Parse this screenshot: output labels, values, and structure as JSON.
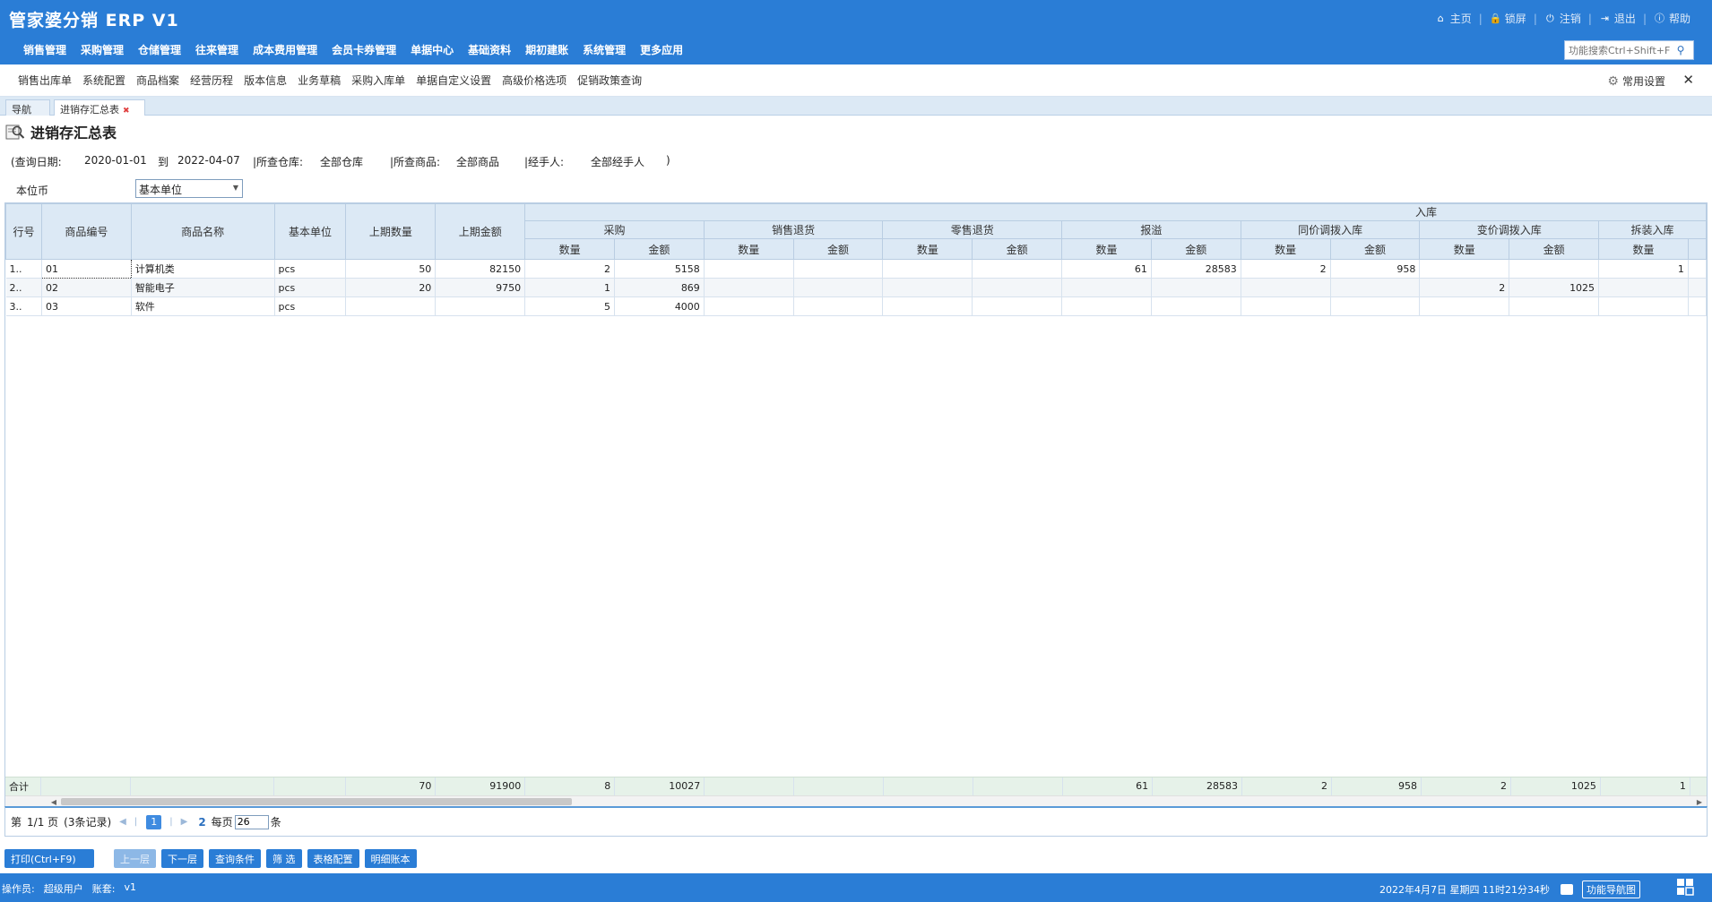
{
  "header": {
    "app_title": "管家婆分销 ERP V1",
    "links": [
      {
        "label": "主页",
        "icon": "home-icon"
      },
      {
        "label": "锁屏",
        "icon": "lock-icon"
      },
      {
        "label": "注销",
        "icon": "power-icon"
      },
      {
        "label": "退出",
        "icon": "exit-icon"
      },
      {
        "label": "帮助",
        "icon": "info-icon"
      }
    ],
    "menu": [
      "销售管理",
      "采购管理",
      "仓储管理",
      "往来管理",
      "成本费用管理",
      "会员卡券管理",
      "单据中心",
      "基础资料",
      "期初建账",
      "系统管理",
      "更多应用"
    ],
    "search_placeholder": "功能搜索Ctrl+Shift+F"
  },
  "subnav": {
    "items": [
      "销售出库单",
      "系统配置",
      "商品档案",
      "经营历程",
      "版本信息",
      "业务草稿",
      "采购入库单",
      "单据自定义设置",
      "高级价格选项",
      "促销政策查询"
    ],
    "common_settings": "常用设置",
    "close": "✕"
  },
  "tabs": {
    "nav": "导航",
    "active": "进销存汇总表",
    "close": "✖"
  },
  "page": {
    "title": "进销存汇总表"
  },
  "query": {
    "date_label": "(查询日期:",
    "date_from": "2020-01-01",
    "to_label": "到",
    "date_to": "2022-04-07",
    "warehouse_label": "|所查仓库:",
    "warehouse": "全部仓库",
    "goods_label": "|所查商品:",
    "goods": "全部商品",
    "handler_label": "|经手人:",
    "handler": "全部经手人",
    "end": ")"
  },
  "unit": {
    "label": "本位币",
    "selected": "基本单位"
  },
  "table": {
    "fixed_headers": [
      "行号",
      "商品编号",
      "商品名称",
      "基本单位",
      "上期数量",
      "上期金额"
    ],
    "group_header": "入库",
    "sub_groups": [
      "采购",
      "销售退货",
      "零售退货",
      "报溢",
      "同价调拨入库",
      "变价调拨入库",
      "拆装入库"
    ],
    "qty_label": "数量",
    "amt_label": "金额",
    "rows": [
      {
        "no": "1..",
        "code": "01",
        "name": "计算机类",
        "unit": "pcs",
        "prev_qty": "50",
        "prev_amt": "82150",
        "cells": [
          "2",
          "5158",
          "",
          "",
          "",
          "",
          "61",
          "28583",
          "2",
          "958",
          "",
          "",
          "1"
        ]
      },
      {
        "no": "2..",
        "code": "02",
        "name": "智能电子",
        "unit": "pcs",
        "prev_qty": "20",
        "prev_amt": "9750",
        "cells": [
          "1",
          "869",
          "",
          "",
          "",
          "",
          "",
          "",
          "",
          "",
          "2",
          "1025",
          ""
        ]
      },
      {
        "no": "3..",
        "code": "03",
        "name": "软件",
        "unit": "pcs",
        "prev_qty": "",
        "prev_amt": "",
        "cells": [
          "5",
          "4000",
          "",
          "",
          "",
          "",
          "",
          "",
          "",
          "",
          "",
          "",
          ""
        ]
      }
    ],
    "total": {
      "label": "合计",
      "prev_qty": "70",
      "prev_amt": "91900",
      "cells": [
        "8",
        "10027",
        "",
        "",
        "",
        "",
        "61",
        "28583",
        "2",
        "958",
        "2",
        "1025",
        "1"
      ]
    }
  },
  "pager": {
    "info_prefix": "第",
    "page_info": "1/1 页",
    "records": "(3条记录)",
    "current_page": "1",
    "next_page": "2",
    "per_page_label": "每页",
    "per_page_value": "26",
    "per_page_suffix": "条"
  },
  "buttons": {
    "print": "打印(Ctrl+F9)",
    "prev_level": "上一层",
    "next_level": "下一层",
    "query_conditions": "查询条件",
    "filter": "筛 选",
    "table_config": "表格配置",
    "detail_ledger": "明细账本"
  },
  "status": {
    "operator_label": "操作员:",
    "operator": "超级用户",
    "account_label": "账套:",
    "account": "v1",
    "datetime": "2022年4月7日  星期四  11时21分34秒",
    "func_nav": "功能导航图"
  }
}
